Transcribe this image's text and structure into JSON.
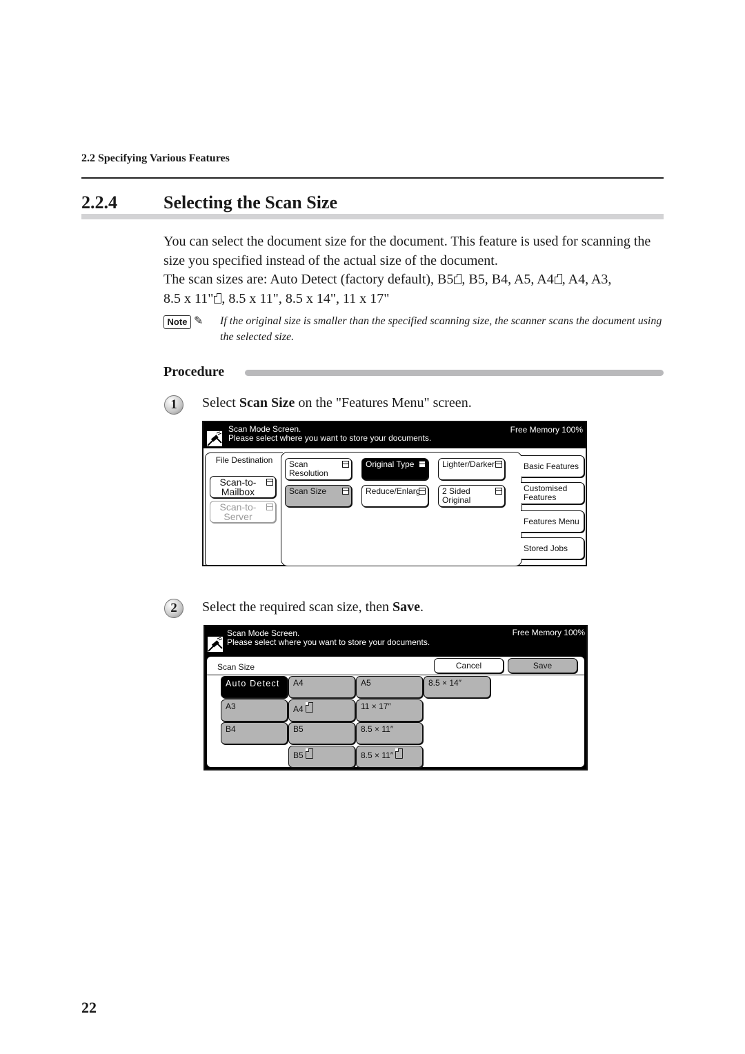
{
  "running_head": "2.2  Specifying Various Features",
  "section": {
    "number": "2.2.4",
    "title": "Selecting the Scan Size"
  },
  "intro": {
    "line1": "You can select the document size for the document. This feature is used for scanning the size you specified instead of the actual size of the document.",
    "sizes_prefix": "The scan sizes are: Auto Detect (factory default), B5",
    "sizes_part2": ", B5, B4, A5, A4",
    "sizes_part3": ", A4, A3,",
    "sizes_part4": "8.5  x 11\"",
    "sizes_part5": ", 8.5 x 11\", 8.5 x 14\", 11 x 17\""
  },
  "note": {
    "badge": "Note",
    "text": "If the original size is smaller than the specified scanning size, the scanner scans the document using the selected size."
  },
  "procedure_label": "Procedure",
  "steps": [
    {
      "number": "1",
      "pre": "Select ",
      "bold": "Scan Size",
      "post": " on the \"Features Menu\" screen."
    },
    {
      "number": "2",
      "pre": "Select the required scan size, then ",
      "bold": "Save",
      "post": "."
    }
  ],
  "screen1": {
    "header_line1": "Scan Mode Screen.",
    "header_line2": "Please select where you want to store your documents.",
    "free_memory": "Free Memory  100%",
    "file_destination": "File Destination",
    "destinations": [
      {
        "label": "Scan-to-Mailbox",
        "state": "normal"
      },
      {
        "label": "Scan-to-Server",
        "state": "disabled"
      }
    ],
    "features": [
      {
        "label": "Scan Resolution",
        "state": "normal"
      },
      {
        "label": "Original Type",
        "state": "selected-black"
      },
      {
        "label": "Lighter/Darker",
        "state": "normal"
      },
      {
        "label": "Scan Size",
        "state": "highlighted-gray"
      },
      {
        "label": "Reduce/Enlarge",
        "state": "normal"
      },
      {
        "label": "2 Sided Original",
        "state": "normal"
      }
    ],
    "tabs": [
      "Basic Features",
      "Customised Features",
      "Features Menu",
      "Stored Jobs"
    ]
  },
  "screen2": {
    "header_line1": "Scan Mode Screen.",
    "header_line2": "Please select where you want to store your documents.",
    "free_memory": "Free Memory  100%",
    "title": "Scan Size",
    "cancel": "Cancel",
    "save": "Save",
    "sizes": [
      {
        "label": "Auto Detect",
        "selected": true
      },
      {
        "label": "A4"
      },
      {
        "label": "A5"
      },
      {
        "label": "8.5 × 14″"
      },
      {
        "label": "A3"
      },
      {
        "label": "A4",
        "portrait_icon": true
      },
      {
        "label": "11 × 17″"
      },
      {
        "label": "B4"
      },
      {
        "label": "B5"
      },
      {
        "label": "8.5 × 11″"
      },
      {
        "label": "B5",
        "portrait_icon": true
      },
      {
        "label": "8.5 × 11″",
        "portrait_icon": true
      }
    ]
  },
  "page_number": "22"
}
